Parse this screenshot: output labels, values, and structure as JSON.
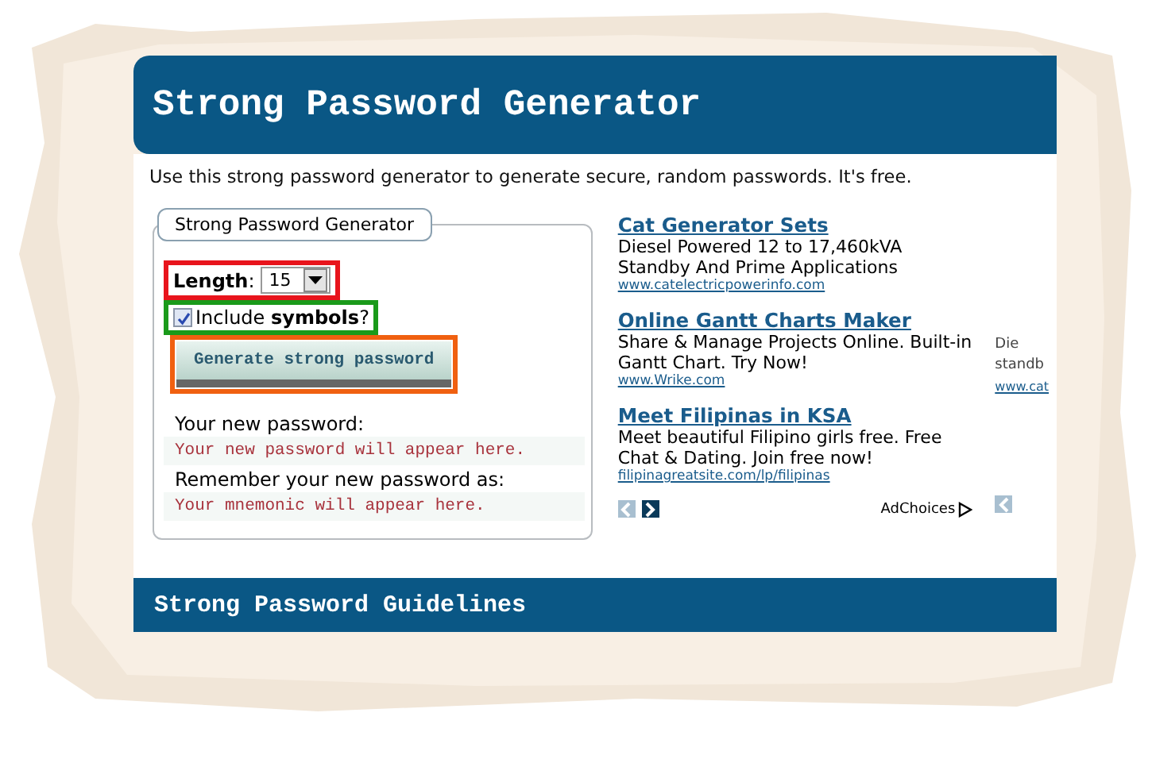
{
  "header": {
    "title": "Strong Password Generator"
  },
  "intro": "Use this strong password generator to generate secure, random passwords. It's free.",
  "generator": {
    "legend": "Strong Password Generator",
    "length": {
      "label": "Length",
      "suffix": ":",
      "value": "15",
      "color": "#e8141c"
    },
    "symbols": {
      "label": "Include **symbols**?",
      "checked": true,
      "color": "#1a9a1a"
    },
    "button": {
      "label": "Generate strong password",
      "color": "#f06010"
    },
    "outputs": [
      {
        "label": "Your new password:",
        "value": "Your new password will appear here."
      },
      {
        "label": "Remember your new password as:",
        "value": "Your mnemonic will appear here."
      }
    ]
  },
  "ads": [
    {
      "title": "Cat Generator Sets",
      "text": "Diesel Powered 12 to 17,460kVA Standby And Prime Applications",
      "url": "www.catelectricpowerinfo.com"
    },
    {
      "title": "Online Gantt Charts Maker",
      "text": "Share & Manage Projects Online. Built-in Gantt Chart. Try Now!",
      "url": "www.Wrike.com"
    },
    {
      "title": "Meet Filipinas in KSA",
      "text": "Meet beautiful Filipino girls free. Free Chat & Dating. Join free now!",
      "url": "filipinagreatsite.com/lp/filipinas"
    }
  ],
  "ad_nav": [
    {
      "kind": "prev",
      "disabled": true
    },
    {
      "kind": "next",
      "disabled": false
    }
  ],
  "ad_choices": "AdChoices",
  "next_ad_peek": {
    "lines": [
      "Die",
      "standb"
    ],
    "url": "www.cat"
  },
  "guidelines": {
    "title": "Strong Password Guidelines"
  }
}
